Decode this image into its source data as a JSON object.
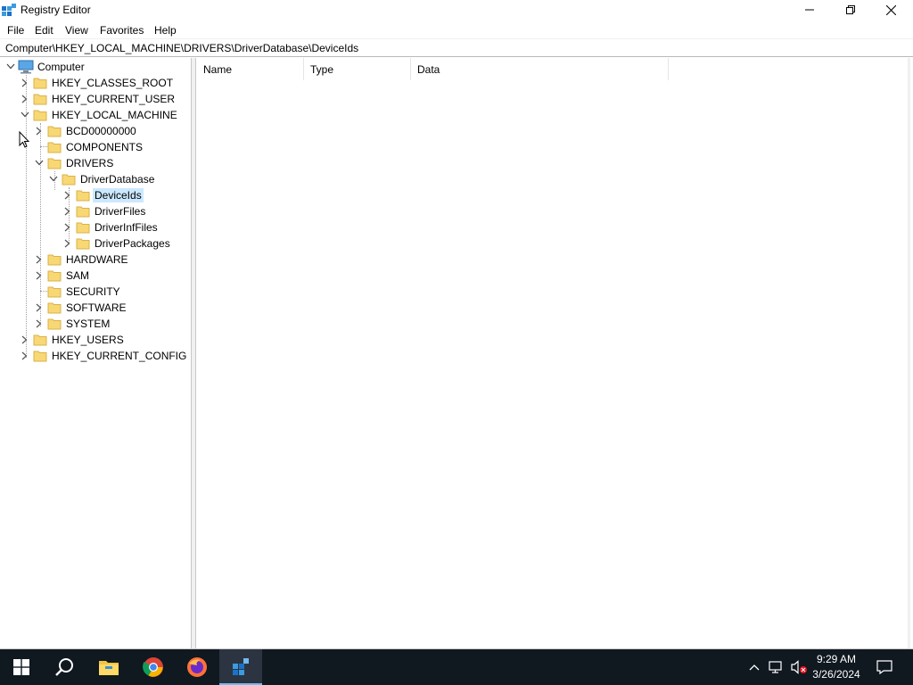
{
  "window": {
    "title": "Registry Editor",
    "controls": {
      "minimize": "minimize-icon",
      "maximize": "restore-icon",
      "close": "close-icon"
    }
  },
  "menu": {
    "items": [
      "File",
      "Edit",
      "View",
      "Favorites",
      "Help"
    ]
  },
  "address": {
    "path": "Computer\\HKEY_LOCAL_MACHINE\\DRIVERS\\DriverDatabase\\DeviceIds"
  },
  "tree": {
    "root": "Computer",
    "nodes": {
      "hkcr": "HKEY_CLASSES_ROOT",
      "hkcu": "HKEY_CURRENT_USER",
      "hklm": "HKEY_LOCAL_MACHINE",
      "bcd": "BCD00000000",
      "components": "COMPONENTS",
      "drivers": "DRIVERS",
      "driverdatabase": "DriverDatabase",
      "deviceids": "DeviceIds",
      "driverfiles": "DriverFiles",
      "driverinffiles": "DriverInfFiles",
      "driverpackages": "DriverPackages",
      "hardware": "HARDWARE",
      "sam": "SAM",
      "security": "SECURITY",
      "software": "SOFTWARE",
      "system": "SYSTEM",
      "hku": "HKEY_USERS",
      "hkcc": "HKEY_CURRENT_CONFIG"
    },
    "selected": "DeviceIds"
  },
  "list": {
    "columns": [
      "Name",
      "Type",
      "Data"
    ],
    "rows": []
  },
  "taskbar": {
    "apps": [
      "start-icon",
      "search-icon",
      "file-explorer-icon",
      "chrome-icon",
      "firefox-icon",
      "registry-editor-icon"
    ],
    "clock": {
      "time": "9:29 AM",
      "date": "3/26/2024"
    }
  },
  "colors": {
    "selection": "#cce8ff",
    "folder": "#f8d775",
    "taskbar": "#101820",
    "taskbar_active_indicator": "#76b9ed"
  }
}
